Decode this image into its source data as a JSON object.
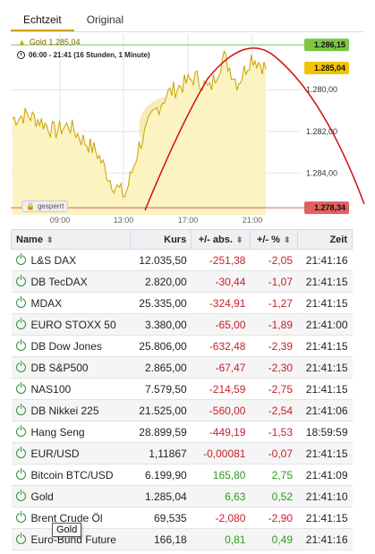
{
  "tabs": [
    "Echtzeit",
    "Original"
  ],
  "chart": {
    "legend_label": "Gold  1.285,04",
    "time_label": "06:00 - 21:41   (16 Stunden, 1 Minute)",
    "locked_label": "gesperrt",
    "y_ticks": [
      "1.284,00",
      "1.282,00",
      "1.280,00"
    ],
    "x_ticks": [
      "09:00",
      "13:00",
      "17:00",
      "21:00"
    ],
    "tag_high": "1.286,15",
    "tag_current": "1.285,04",
    "tag_low": "1.278,34",
    "colors": {
      "line": "#c8a200",
      "fill": "#fbf3c0",
      "high": "#7dc644",
      "low": "#e06060",
      "annotation": "#d01010"
    }
  },
  "chart_data": {
    "type": "area",
    "title": "",
    "xlabel": "",
    "ylabel": "",
    "x": [
      "06:00",
      "07:00",
      "08:00",
      "09:00",
      "10:00",
      "11:00",
      "12:00",
      "13:00",
      "13:30",
      "14:00",
      "15:00",
      "16:00",
      "17:00",
      "18:00",
      "19:00",
      "20:00",
      "20:30",
      "21:00",
      "21:41"
    ],
    "series": [
      {
        "values": [
          1282.6,
          1282.8,
          1282.5,
          1282.0,
          1282.3,
          1281.6,
          1281.0,
          1279.6,
          1278.9,
          1281.3,
          1282.8,
          1283.8,
          1284.2,
          1284.6,
          1284.0,
          1285.6,
          1284.3,
          1285.6,
          1285.04
        ]
      }
    ],
    "ylim": [
      1278.0,
      1286.5
    ],
    "y_ticks": [
      1280.0,
      1282.0,
      1284.0
    ],
    "x_ticks": [
      "09:00",
      "13:00",
      "17:00",
      "21:00"
    ],
    "markers": {
      "high": 1286.15,
      "current": 1285.04,
      "low": 1278.34
    }
  },
  "table": {
    "headers": [
      "Name",
      "Kurs",
      "+/- abs.",
      "+/- %",
      "Zeit"
    ],
    "rows": [
      [
        "L&S DAX",
        "12.035,50",
        "-251,38",
        "-2,05",
        "21:41:16"
      ],
      [
        "DB TecDAX",
        "2.820,00",
        "-30,44",
        "-1,07",
        "21:41:15"
      ],
      [
        "MDAX",
        "25.335,00",
        "-324,91",
        "-1,27",
        "21:41:15"
      ],
      [
        "EURO STOXX 50",
        "3.380,00",
        "-65,00",
        "-1,89",
        "21:41:00"
      ],
      [
        "DB Dow Jones",
        "25.806,00",
        "-632,48",
        "-2,39",
        "21:41:15"
      ],
      [
        "DB S&P500",
        "2.865,00",
        "-67,47",
        "-2,30",
        "21:41:15"
      ],
      [
        "NAS100",
        "7.579,50",
        "-214,59",
        "-2,75",
        "21:41:15"
      ],
      [
        "DB Nikkei 225",
        "21.525,00",
        "-560,00",
        "-2,54",
        "21:41:06"
      ],
      [
        "Hang Seng",
        "28.899,59",
        "-449,19",
        "-1,53",
        "18:59:59"
      ],
      [
        "EUR/USD",
        "1,11867",
        "-0,00081",
        "-0,07",
        "21:41:15"
      ],
      [
        "Bitcoin BTC/USD",
        "6.199,90",
        "165,80",
        "2,75",
        "21:41:09"
      ],
      [
        "Gold",
        "1.285,04",
        "6,63",
        "0,52",
        "21:41:10"
      ],
      [
        "Brent Crude Öl",
        "69,535",
        "-2,080",
        "-2,90",
        "21:41:15"
      ],
      [
        "Euro-Bund Future",
        "166,18",
        "0,81",
        "0,49",
        "21:41:16"
      ]
    ]
  },
  "tooltip": "Gold"
}
